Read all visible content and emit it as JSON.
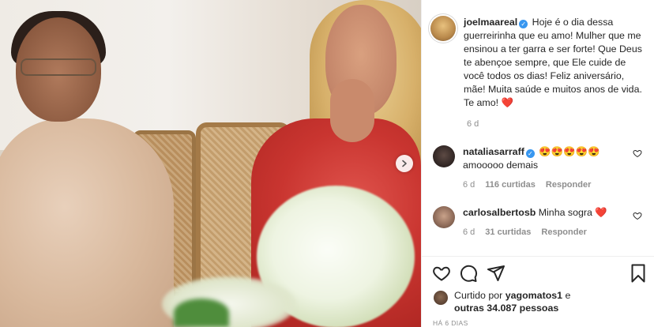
{
  "post": {
    "image_alt_description": "",
    "next_button_icon": "chevron-right-icon"
  },
  "caption": {
    "username": "joelmaareal",
    "verified_icon": "verified-badge-icon",
    "text": "Hoje é o dia dessa guerreirinha que eu amo! Mulher que me ensinou a ter garra e ser forte! Que Deus te abençoe sempre, que Ele cuide de você todos os dias! Feliz aniversário, mãe! Muita saúde e muitos anos de vida. Te amo!",
    "emoji": "❤️",
    "time": "6 d"
  },
  "comments": [
    {
      "username": "nataliasarraff",
      "verified_icon": "verified-badge-icon",
      "text_line1": "😍😍😍😍😍",
      "text_line2": "amooooo demais",
      "time": "6 d",
      "likes": "116 curtidas",
      "reply": "Responder"
    },
    {
      "username": "carlosalbertosb",
      "text": "Minha sogra",
      "emoji": "❤️",
      "time": "6 d",
      "likes": "31 curtidas",
      "reply": "Responder"
    }
  ],
  "actions": {
    "like_icon": "heart-outline-icon",
    "comment_icon": "comment-icon",
    "share_icon": "share-icon",
    "save_icon": "bookmark-icon"
  },
  "likes_summary": {
    "prefix": "Curtido por",
    "first_user": "yagomatos1",
    "connector": "e",
    "others": "outras 34.087 pessoas"
  },
  "date_label": "HÁ 6 DIAS",
  "colors": {
    "verified": "#3897f0",
    "heart": "#e0245e",
    "meta_gray": "#8e8e8e",
    "text": "#262626"
  }
}
